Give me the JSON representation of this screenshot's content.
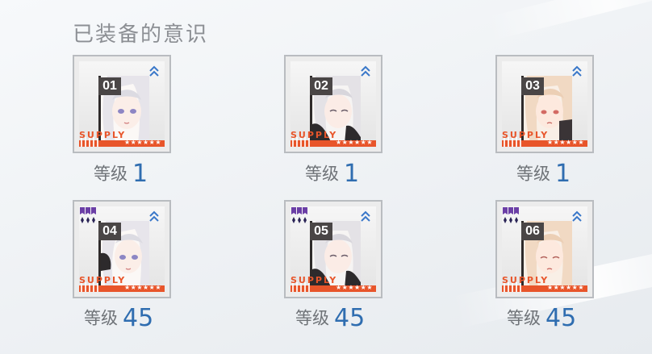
{
  "section_title": "已装备的意识",
  "cards": [
    {
      "number": "01",
      "tag": "SUPPLY",
      "stars": "★★★★★★",
      "level_label": "等级",
      "level_value": "1",
      "upgrade_icon": "double-chevron-up-icon"
    },
    {
      "number": "02",
      "tag": "SUPPLY",
      "stars": "★★★★★★",
      "level_label": "等级",
      "level_value": "1",
      "upgrade_icon": "double-chevron-up-icon"
    },
    {
      "number": "03",
      "tag": "SUPPLY",
      "stars": "★★★★★★",
      "level_label": "等级",
      "level_value": "1",
      "upgrade_icon": "double-chevron-up-icon"
    },
    {
      "number": "04",
      "tag": "SUPPLY",
      "stars": "★★★★★★",
      "level_label": "等级",
      "level_value": "45",
      "upgrade_icon": "double-chevron-up-icon",
      "rank_icon": "purple-rank-badge-icon"
    },
    {
      "number": "05",
      "tag": "SUPPLY",
      "stars": "★★★★★★",
      "level_label": "等级",
      "level_value": "45",
      "upgrade_icon": "double-chevron-up-icon",
      "rank_icon": "purple-rank-badge-icon"
    },
    {
      "number": "06",
      "tag": "SUPPLY",
      "stars": "★★★★★★",
      "level_label": "等级",
      "level_value": "45",
      "upgrade_icon": "double-chevron-up-icon",
      "rank_icon": "purple-rank-badge-icon"
    }
  ],
  "colors": {
    "accent_orange": "#e8552a",
    "level_blue": "#2f6db0",
    "chevron_blue": "#3a78c9",
    "rank_purple": "#6b3fa6"
  }
}
